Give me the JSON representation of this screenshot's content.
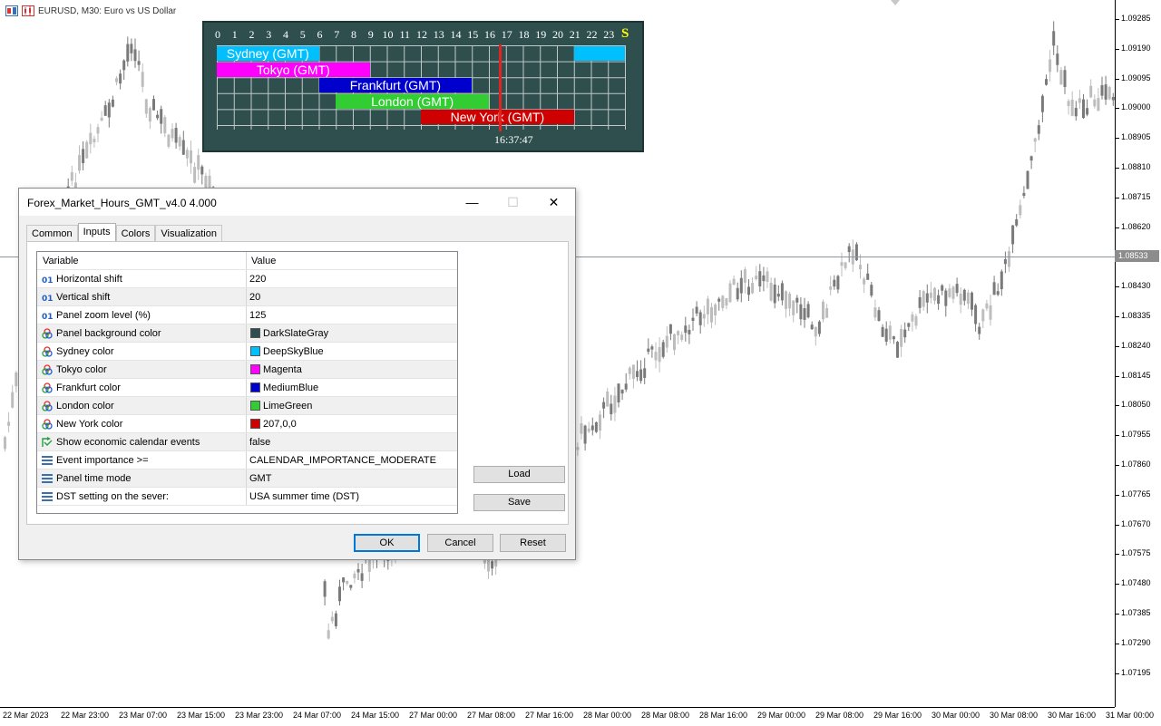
{
  "chart": {
    "title": "EURUSD, M30:  Euro vs US Dollar",
    "current_price": "1.08533",
    "price_ticks": [
      "1.09285",
      "1.09190",
      "1.09095",
      "1.09000",
      "1.08905",
      "1.08810",
      "1.08715",
      "1.08620",
      "1.08525",
      "1.08430",
      "1.08335",
      "1.08240",
      "1.08145",
      "1.08050",
      "1.07955",
      "1.07860",
      "1.07765",
      "1.07670",
      "1.07575",
      "1.07480",
      "1.07385",
      "1.07290",
      "1.07195"
    ],
    "time_ticks": [
      "22 Mar 2023",
      "22 Mar 23:00",
      "23 Mar 07:00",
      "23 Mar 15:00",
      "23 Mar 23:00",
      "24 Mar 07:00",
      "24 Mar 15:00",
      "27 Mar 00:00",
      "27 Mar 08:00",
      "27 Mar 16:00",
      "28 Mar 00:00",
      "28 Mar 08:00",
      "28 Mar 16:00",
      "29 Mar 00:00",
      "29 Mar 08:00",
      "29 Mar 16:00",
      "30 Mar 00:00",
      "30 Mar 08:00",
      "30 Mar 16:00",
      "31 Mar 00:00"
    ],
    "colors": {
      "candle": "#bdbdbd",
      "candle_dark": "#7a7a7a",
      "axis": "#000000"
    }
  },
  "panel": {
    "hours": [
      "0",
      "1",
      "2",
      "3",
      "4",
      "5",
      "6",
      "7",
      "8",
      "9",
      "10",
      "11",
      "12",
      "13",
      "14",
      "15",
      "16",
      "17",
      "18",
      "19",
      "20",
      "21",
      "22",
      "23"
    ],
    "s_mark": "S",
    "clock": "16:37:47",
    "current_hour": 16.63,
    "sessions": [
      {
        "label": "Sydney (GMT)",
        "color": "#00bfff",
        "start": 0,
        "end": 6,
        "wrap_start": 21,
        "wrap_end": 24
      },
      {
        "label": "Tokyo (GMT)",
        "color": "#ff00ff",
        "start": 0,
        "end": 9
      },
      {
        "label": "Frankfurt (GMT)",
        "color": "#0000cd",
        "start": 6,
        "end": 15
      },
      {
        "label": "London (GMT)",
        "color": "#32cd32",
        "start": 7,
        "end": 16
      },
      {
        "label": "New York (GMT)",
        "color": "#cf0000",
        "start": 12,
        "end": 21
      }
    ],
    "colors": {
      "background": "#2f4f4f",
      "grid": "#c0c8c8",
      "now_line": "#e52222"
    }
  },
  "dialog": {
    "title": "Forex_Market_Hours_GMT_v4.0 4.000",
    "tabs": [
      "Common",
      "Inputs",
      "Colors",
      "Visualization"
    ],
    "active_tab": "Inputs",
    "headers": {
      "variable": "Variable",
      "value": "Value"
    },
    "rows": [
      {
        "icon": "int",
        "variable": "Horizontal shift",
        "value": "220"
      },
      {
        "icon": "int",
        "variable": "Vertical shift",
        "value": "20"
      },
      {
        "icon": "int",
        "variable": "Panel zoom level (%)",
        "value": "125"
      },
      {
        "icon": "color",
        "variable": "Panel background color",
        "value": "DarkSlateGray",
        "swatch": "#2f4f4f"
      },
      {
        "icon": "color",
        "variable": "Sydney color",
        "value": "DeepSkyBlue",
        "swatch": "#00bfff"
      },
      {
        "icon": "color",
        "variable": "Tokyo color",
        "value": "Magenta",
        "swatch": "#ff00ff"
      },
      {
        "icon": "color",
        "variable": "Frankfurt color",
        "value": "MediumBlue",
        "swatch": "#0000cd"
      },
      {
        "icon": "color",
        "variable": "London color",
        "value": "LimeGreen",
        "swatch": "#32cd32"
      },
      {
        "icon": "color",
        "variable": "New York color",
        "value": "207,0,0",
        "swatch": "#cf0000"
      },
      {
        "icon": "bool",
        "variable": "Show economic calendar events",
        "value": "false"
      },
      {
        "icon": "enum",
        "variable": "Event importance >=",
        "value": "CALENDAR_IMPORTANCE_MODERATE"
      },
      {
        "icon": "enum",
        "variable": "Panel time mode",
        "value": "GMT"
      },
      {
        "icon": "enum",
        "variable": "DST setting on the sever:",
        "value": "USA summer time (DST)"
      }
    ],
    "buttons": {
      "load": "Load",
      "save": "Save",
      "ok": "OK",
      "cancel": "Cancel",
      "reset": "Reset"
    },
    "window_controls": {
      "minimize": "—",
      "maximize": "☐",
      "close": "✕"
    }
  }
}
